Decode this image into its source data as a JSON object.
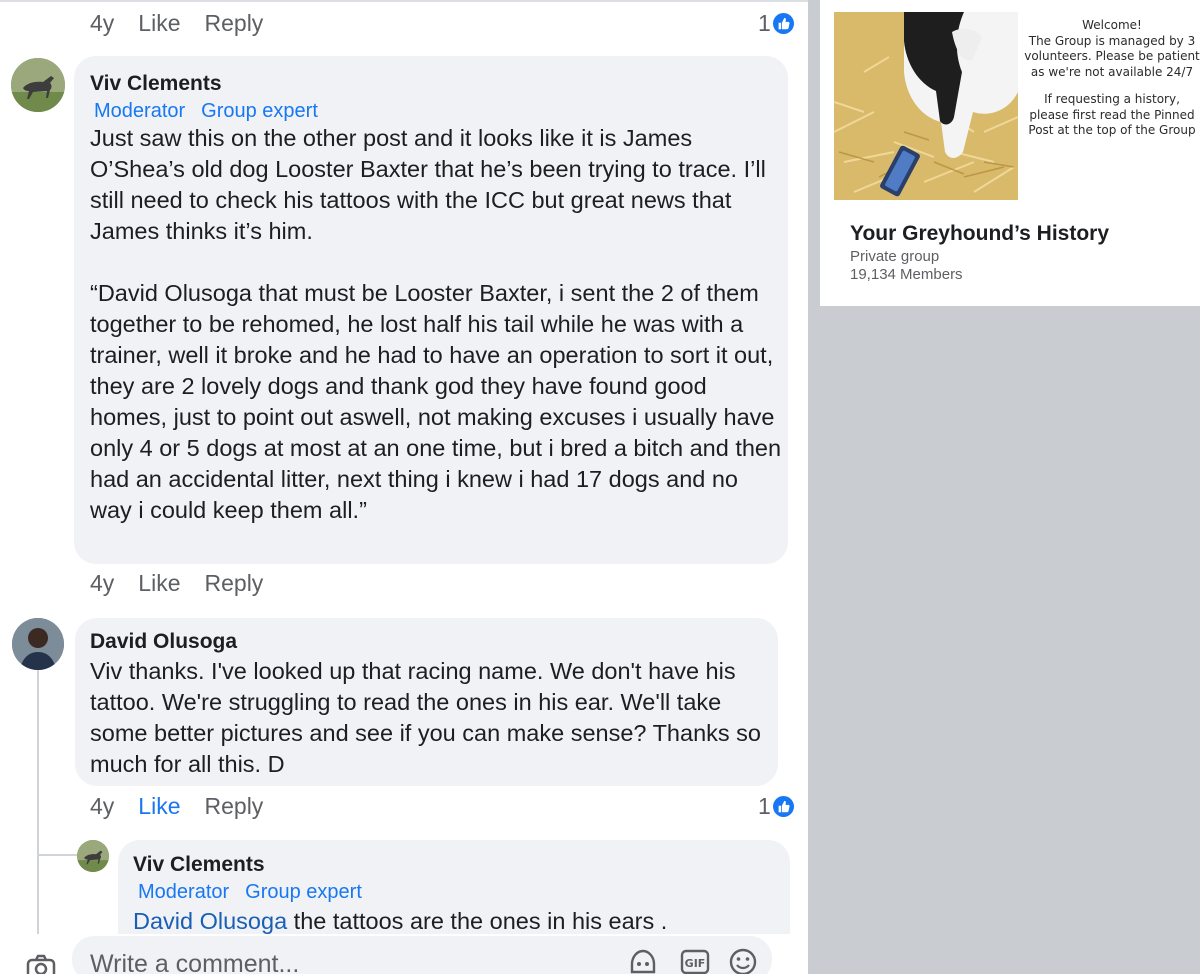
{
  "comments": [
    {
      "actions": {
        "age": "4y",
        "like": "Like",
        "reply": "Reply",
        "reaction_count": "1"
      }
    },
    {
      "author": "Viv Clements",
      "badges": [
        "Moderator",
        "Group expert"
      ],
      "text": "Just saw this on the other post and it looks like it is James O’Shea’s old dog Looster Baxter that he’s been trying to trace. I’ll still need to check his tattoos with the ICC but great news that James thinks it’s him.\n\n“David Olusoga that must be Looster Baxter, i sent the 2 of them together to be rehomed, he lost half his tail while he was with a trainer, well it broke and he had to have an operation to sort it out, they are 2 lovely dogs and thank god they have found good homes, just to point out aswell, not making excuses i usually have only 4 or 5 dogs at most at an one time, but i bred a bitch and then had an accidental litter, next thing i knew i had 17 dogs and no way i could keep them all.”",
      "actions": {
        "age": "4y",
        "like": "Like",
        "reply": "Reply"
      }
    },
    {
      "author": "David Olusoga",
      "text": "Viv thanks. I've looked up that racing name. We don't have his tattoo. We're struggling to read the ones in his ear. We'll take some better pictures and see if you can make sense? Thanks so much for all this. D",
      "actions": {
        "age": "4y",
        "like": "Like",
        "reply": "Reply",
        "reaction_count": "1"
      }
    },
    {
      "author": "Viv Clements",
      "badges": [
        "Moderator",
        "Group expert"
      ],
      "mention": "David Olusoga",
      "text": " the tattoos are the ones in his ears ."
    }
  ],
  "composer": {
    "placeholder": "Write a comment..."
  },
  "group": {
    "name": "Your Greyhound’s History",
    "privacy": "Private group",
    "members": "19,134 Members",
    "cover_text": {
      "welcome": "Welcome!",
      "line1": "The Group is managed by 3 volunteers. Please be patient as we're not available 24/7",
      "line2": "If requesting a history, please first read the Pinned Post at the top of the Group"
    }
  },
  "colors": {
    "accent": "#1877f2",
    "bubble": "#f0f2f5",
    "sidebar_bg": "#c9ccd1"
  },
  "icons": [
    "like-reaction-icon",
    "camera-icon",
    "avatar-sticker-icon",
    "gif-icon",
    "emoji-icon"
  ]
}
